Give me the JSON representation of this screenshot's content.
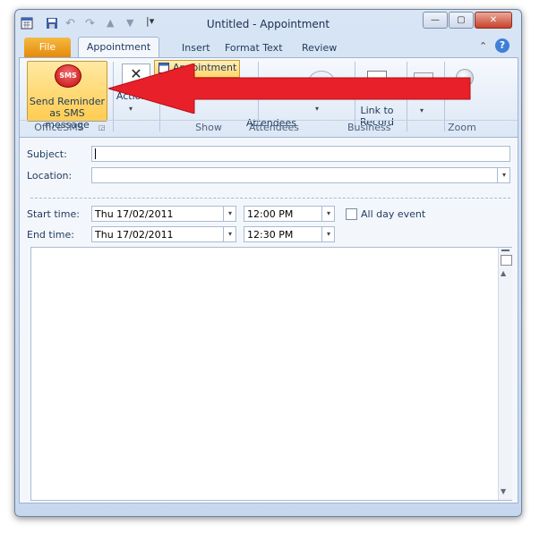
{
  "window": {
    "title": "Untitled  -  Appointment"
  },
  "tabs": [
    "File",
    "Appointment",
    "Insert",
    "Format Text",
    "Review"
  ],
  "ribbon": {
    "sms_button_label": "Send Reminder as SMS message",
    "sms_icon_text": "SMS",
    "actions_label": "Actions",
    "appointment_label": "Appointment",
    "attendees_button": "Attendees",
    "link_to_record": "Link to Record",
    "groups": [
      "OfficeSMS",
      "Show",
      "Attendees",
      "Business",
      "Zoom"
    ]
  },
  "form": {
    "subject_label": "Subject:",
    "subject_value": "",
    "location_label": "Location:",
    "location_value": "",
    "start_label": "Start time:",
    "start_date": "Thu 17/02/2011",
    "start_time": "12:00 PM",
    "end_label": "End time:",
    "end_date": "Thu 17/02/2011",
    "end_time": "12:30 PM",
    "all_day_label": "All day event",
    "all_day_checked": false
  },
  "colors": {
    "arrow": "#e8202a",
    "file_tab": "#e58a0a",
    "sms_highlight": "#ffcc4f"
  }
}
